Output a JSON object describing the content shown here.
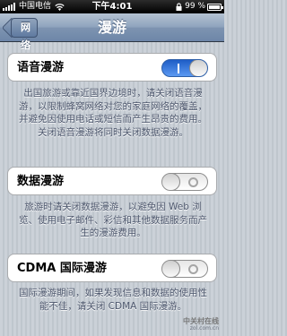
{
  "status_bar": {
    "carrier": "中国电信",
    "time": "下午4:01",
    "battery_percent": "99 %",
    "battery_level": 0.99,
    "icons": [
      "signal-icon",
      "wifi-icon",
      "lock-icon",
      "battery-icon"
    ]
  },
  "nav": {
    "back_label": "网络",
    "title": "漫游"
  },
  "settings": [
    {
      "label": "语音漫游",
      "state": "on",
      "description": "出国旅游或靠近国界边境时，请关闭语音漫游，以限制蜂窝网络对您的家庭网络的覆盖，并避免因使用电话或短信而产生昂贵的费用。关闭语音漫游将同时关闭数据漫游。"
    },
    {
      "label": "数据漫游",
      "state": "off",
      "description": "旅游时请关闭数据漫游，以避免因 Web 浏览、使用电子邮件、彩信和其他数据服务而产生的漫游费用。"
    },
    {
      "label": "CDMA 国际漫游",
      "state": "off",
      "description": "国际漫游期间，如果发现信息和数据的使用性能不佳，请关闭 CDMA 国际漫游。"
    }
  ],
  "watermark": {
    "line1": "中关村在线",
    "line2": "zol.com.cn"
  },
  "colors": {
    "background": "#c5ccd4",
    "nav_bar": "#7e94b1",
    "switch_on": "#2f76e2",
    "description_text": "#4c566c"
  }
}
